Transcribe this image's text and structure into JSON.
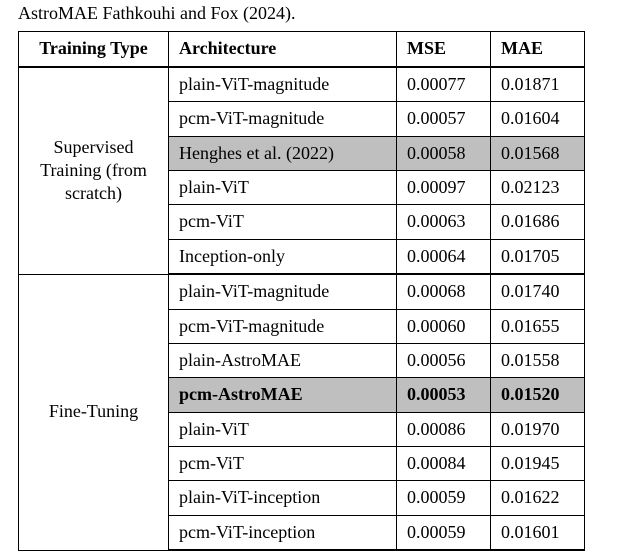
{
  "caption": "AstroMAE Fathkouhi and Fox (2024).",
  "headers": {
    "training_type": "Training Type",
    "architecture": "Architecture",
    "mse": "MSE",
    "mae": "MAE"
  },
  "groups": [
    {
      "label": "Supervised Training (from scratch)",
      "rows": [
        {
          "arch": "plain-ViT-magnitude",
          "mse": "0.00077",
          "mae": "0.01871",
          "highlight": false,
          "bold": false
        },
        {
          "arch": "pcm-ViT-magnitude",
          "mse": "0.00057",
          "mae": "0.01604",
          "highlight": false,
          "bold": false
        },
        {
          "arch": "Henghes et al. (2022)",
          "mse": "0.00058",
          "mae": "0.01568",
          "highlight": true,
          "bold": false
        },
        {
          "arch": "plain-ViT",
          "mse": "0.00097",
          "mae": "0.02123",
          "highlight": false,
          "bold": false
        },
        {
          "arch": "pcm-ViT",
          "mse": "0.00063",
          "mae": "0.01686",
          "highlight": false,
          "bold": false
        },
        {
          "arch": "Inception-only",
          "mse": "0.00064",
          "mae": "0.01705",
          "highlight": false,
          "bold": false
        }
      ]
    },
    {
      "label": "Fine-Tuning",
      "rows": [
        {
          "arch": "plain-ViT-magnitude",
          "mse": "0.00068",
          "mae": "0.01740",
          "highlight": false,
          "bold": false
        },
        {
          "arch": "pcm-ViT-magnitude",
          "mse": "0.00060",
          "mae": "0.01655",
          "highlight": false,
          "bold": false
        },
        {
          "arch": "plain-AstroMAE",
          "mse": "0.00056",
          "mae": "0.01558",
          "highlight": false,
          "bold": false
        },
        {
          "arch": "pcm-AstroMAE",
          "mse": "0.00053",
          "mae": "0.01520",
          "highlight": true,
          "bold": true
        },
        {
          "arch": "plain-ViT",
          "mse": "0.00086",
          "mae": "0.01970",
          "highlight": false,
          "bold": false
        },
        {
          "arch": "pcm-ViT",
          "mse": "0.00084",
          "mae": "0.01945",
          "highlight": false,
          "bold": false
        },
        {
          "arch": "plain-ViT-inception",
          "mse": "0.00059",
          "mae": "0.01622",
          "highlight": false,
          "bold": false
        },
        {
          "arch": "pcm-ViT-inception",
          "mse": "0.00059",
          "mae": "0.01601",
          "highlight": false,
          "bold": false
        }
      ]
    }
  ]
}
